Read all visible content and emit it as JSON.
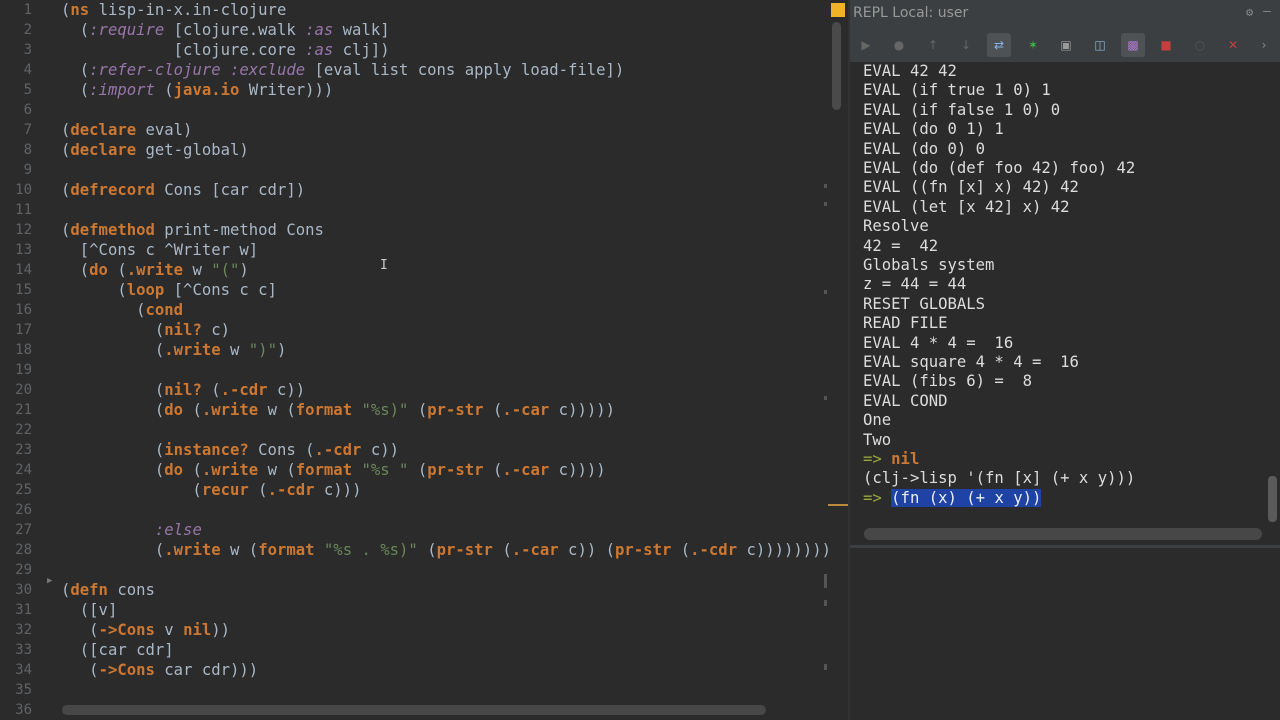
{
  "editor": {
    "line_numbers": [
      "1",
      "2",
      "3",
      "4",
      "5",
      "6",
      "7",
      "8",
      "9",
      "10",
      "11",
      "12",
      "13",
      "14",
      "15",
      "16",
      "17",
      "18",
      "19",
      "20",
      "21",
      "22",
      "23",
      "24",
      "25",
      "26",
      "27",
      "28",
      "29",
      "30",
      "31",
      "32",
      "33",
      "34",
      "35",
      "36"
    ],
    "lines": [
      "(ns lisp-in-x.in-clojure",
      "  (:require [clojure.walk :as walk]",
      "            [clojure.core :as clj])",
      "  (:refer-clojure :exclude [eval list cons apply load-file])",
      "  (:import (java.io Writer)))",
      "",
      "(declare eval)",
      "(declare get-global)",
      "",
      "(defrecord Cons [car cdr])",
      "",
      "(defmethod print-method Cons",
      "  [^Cons c ^Writer w]",
      "  (do (.write w \"(\")",
      "      (loop [^Cons c c]",
      "        (cond",
      "          (nil? c)",
      "          (.write w \")\")",
      "",
      "          (nil? (.-cdr c))",
      "          (do (.write w (format \"%s)\" (pr-str (.-car c)))))",
      "",
      "          (instance? Cons (.-cdr c))",
      "          (do (.write w (format \"%s \" (pr-str (.-car c))))",
      "              (recur (.-cdr c)))",
      "",
      "          :else",
      "          (.write w (format \"%s . %s)\" (pr-str (.-car c)) (pr-str (.-cdr c))))))))",
      "",
      "(defn cons",
      "  ([v]",
      "   (->Cons v nil))",
      "  ([car cdr]",
      "   (->Cons car cdr)))",
      "",
      ""
    ]
  },
  "repl": {
    "title": "REPL Local: user",
    "output_lines": [
      "EVAL 42 42",
      "EVAL (if true 1 0) 1",
      "EVAL (if false 1 0) 0",
      "EVAL (do 0 1) 1",
      "EVAL (do 0) 0",
      "EVAL (do (def foo 42) foo) 42",
      "EVAL ((fn [x] x) 42) 42",
      "EVAL (let [x 42] x) 42",
      "Resolve",
      "42 =  42",
      "Globals system",
      "z = 44 = 44",
      "RESET GLOBALS",
      "READ FILE",
      "EVAL 4 * 4 =  16",
      "EVAL square 4 * 4 =  16",
      "EVAL (fibs 6) =  8",
      "EVAL COND",
      "One",
      "Two"
    ],
    "prompt": "=>",
    "nil_result": "nil",
    "last_input": "(clj->lisp '(fn [x] (+ x y)))",
    "last_result": "(fn (x) (+ x y))",
    "toolbar_icons": [
      "run-icon",
      "stop-circle-icon",
      "up-arrow-icon",
      "down-arrow-icon",
      "soft-wrap-icon",
      "bug-icon",
      "layout-icon",
      "trash-icon",
      "history-icon",
      "stop-icon",
      "pin-icon",
      "close-icon"
    ]
  },
  "colors": {
    "background": "#2b2b2b",
    "keyword_orange": "#cc7832",
    "keyword_purple": "#9876aa",
    "string_green": "#6a8759",
    "selection_blue": "#1f43a4",
    "stop_red": "#c63e3e",
    "bug_green": "#3db54a"
  }
}
